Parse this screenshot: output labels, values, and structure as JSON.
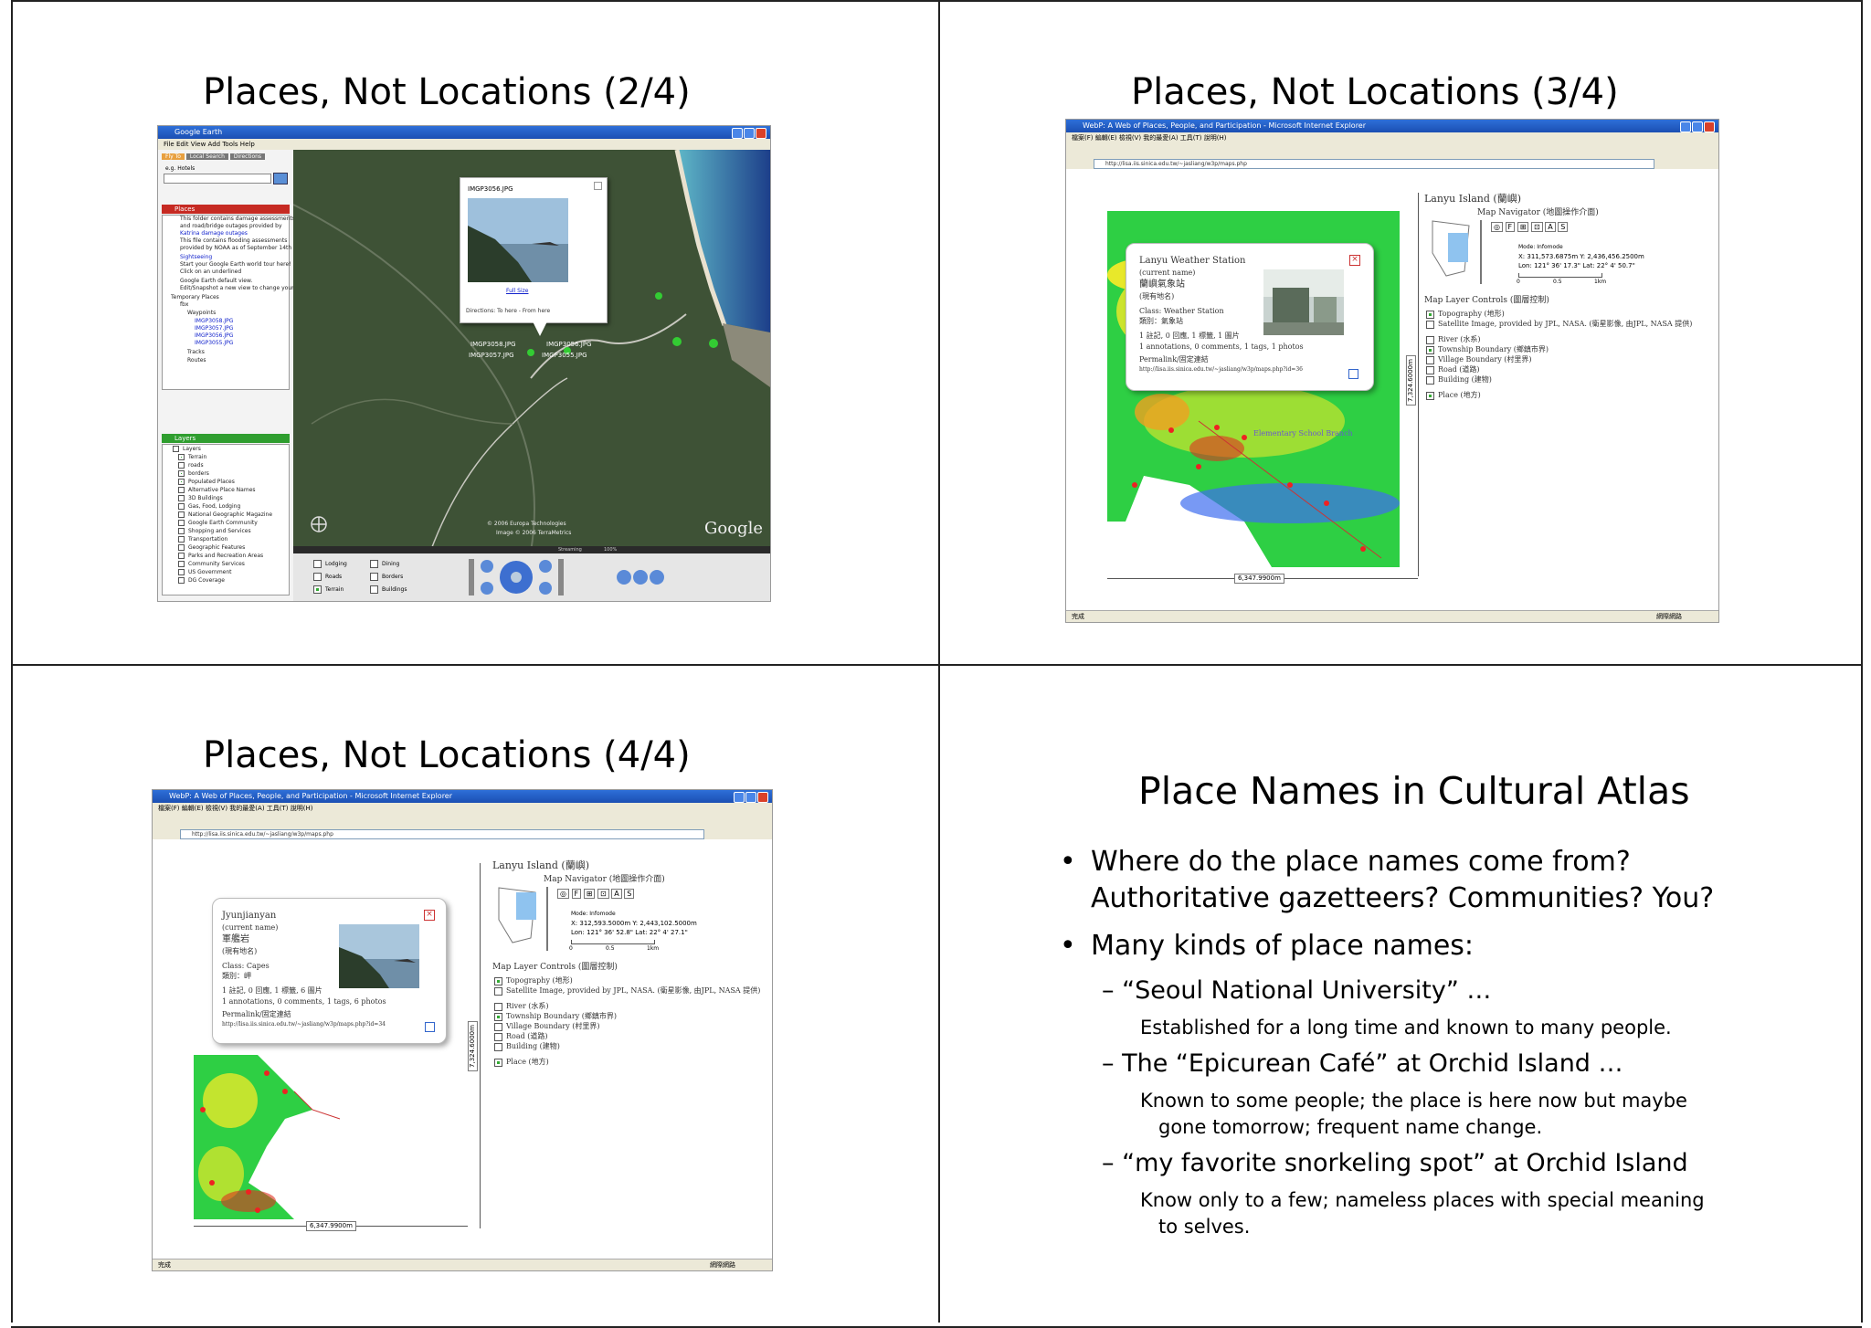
{
  "slides": {
    "s1": {
      "title": "Places, Not Locations (2/4)",
      "app_title": "Google Earth",
      "menu": "File  Edit  View  Add  Tools  Help",
      "tabs": [
        "Fly To",
        "Local Search",
        "Directions"
      ],
      "search_hint": "e.g. Hotels",
      "places_header": "Places",
      "places_items": [
        "This folder contains damage assessments",
        "and road/bridge outages provided by",
        "Katrina damage outages",
        "This file contains flooding assessments",
        "provided by NOAA as of September 14th",
        "Sightseeing",
        "Start your Google Earth world tour here!",
        "Click on an underlined",
        "Google Earth default view.",
        "Edit/Snapshot a new view to change your",
        "Temporary Places",
        "fbx",
        "Waypoints",
        "IMGP3058.JPG",
        "IMGP3057.JPG",
        "IMGP3056.JPG",
        "IMGP3055.JPG",
        "Tracks",
        "Routes"
      ],
      "layers_header": "Layers",
      "layers_items": [
        "Layers",
        "Terrain",
        "roads",
        "borders",
        "Populated Places",
        "Alternative Place Names",
        "3D Buildings",
        "Gas, Food, Lodging",
        "National Geographic Magazine",
        "Google Earth Community",
        "Shopping and Services",
        "Transportation",
        "Geographic Features",
        "Parks and Recreation Areas",
        "Community Services",
        "US Government",
        "DG Coverage"
      ],
      "popup_title": "IMGP3056.JPG",
      "popup_link": "Full Size",
      "popup_directions": "Directions: To here - From here",
      "waypoint_labels": [
        "IMGP3056.JPG",
        "IMGP3058.JPG",
        "IMGP3057.JPG",
        "IMGP3055.JPG"
      ],
      "copyright1": "© 2006 Europa Technologies",
      "copyright2": "Image © 2006 TerraMetrics",
      "streaming": "Streaming",
      "streaming_pct": "100%",
      "logo": "Google",
      "bottom_layers": [
        "Lodging",
        "Dining",
        "Roads",
        "Borders",
        "Terrain",
        "Buildings"
      ]
    },
    "s2": {
      "title": "Places, Not Locations (3/4)",
      "window_title": "WebP: A Web of Places, People, and Participation - Microsoft Internet Explorer",
      "menu": "檔案(F)  編輯(E)  檢視(V)  我的最愛(A)  工具(T)  說明(H)",
      "address": "http://lisa.iis.sinica.edu.tw/~jasliang/w3p/maps.php",
      "island_title": "Lanyu Island (蘭嶼)",
      "navigator_title": "Map Navigator (地圖操作介面)",
      "nav_buttons": [
        "F",
        "A",
        "S"
      ],
      "mode": "Mode: Infomode",
      "xy": "X: 311,573.6875m   Y: 2,436,456.2500m",
      "lonlat": "Lon: 121° 36' 17.3\"   Lat: 22° 4' 50.7\"",
      "scale_labels": [
        "0",
        "0.5",
        "1km"
      ],
      "layer_controls_title": "Map Layer Controls (圖層控制)",
      "layers": [
        {
          "label": "Topography (地形)",
          "checked": true
        },
        {
          "label": "Satellite Image, provided by JPL, NASA. (衛星影像, 由JPL, NASA 提供)",
          "checked": false
        },
        {
          "label": "River (水系)",
          "checked": false
        },
        {
          "label": "Township Boundary (鄉鎮市界)",
          "checked": true
        },
        {
          "label": "Village Boundary (村里界)",
          "checked": false
        },
        {
          "label": "Road (道路)",
          "checked": false
        },
        {
          "label": "Building (建物)",
          "checked": false
        },
        {
          "label": "Place (地方)",
          "checked": true
        }
      ],
      "popup_lines": [
        "Lanyu Weather Station",
        "(current name)",
        "蘭嶼氣象站",
        "(現有地名)",
        "Class: Weather Station",
        "類別：氣象站",
        "1 註記, 0 回應, 1 標籤, 1 圖片",
        "1 annotations, 0 comments, 1 tags, 1 photos",
        "Permalink/固定連結",
        "http://lisa.iis.sinica.edu.tw/~jasliang/w3p/maps.php?id=36"
      ],
      "map_labels": [
        "Elementary School Branch",
        "Lanyu Weather Station"
      ],
      "width_label": "6,347.9900m",
      "height_label": "7,324.6000m",
      "status_left": "完成",
      "status_right": "網際網路"
    },
    "s3": {
      "title": "Places, Not Locations (4/4)",
      "window_title": "WebP: A Web of Places, People, and Participation - Microsoft Internet Explorer",
      "menu": "檔案(F)  編輯(E)  檢視(V)  我的最愛(A)  工具(T)  說明(H)",
      "address": "http://lisa.iis.sinica.edu.tw/~jasliang/w3p/maps.php",
      "island_title": "Lanyu Island (蘭嶼)",
      "navigator_title": "Map Navigator (地圖操作介面)",
      "nav_buttons": [
        "F",
        "A",
        "S"
      ],
      "mode": "Mode: Infomode",
      "xy": "X: 312,593.5000m   Y: 2,443,102.5000m",
      "lonlat": "Lon: 121° 36' 52.8\"   Lat: 22° 4' 27.1\"",
      "scale_labels": [
        "0",
        "0.5",
        "1km"
      ],
      "layer_controls_title": "Map Layer Controls (圖層控制)",
      "layers": [
        {
          "label": "Topography (地形)",
          "checked": true
        },
        {
          "label": "Satellite Image, provided by JPL, NASA. (衛星影像, 由JPL, NASA 提供)",
          "checked": false
        },
        {
          "label": "River (水系)",
          "checked": false
        },
        {
          "label": "Township Boundary (鄉鎮市界)",
          "checked": true
        },
        {
          "label": "Village Boundary (村里界)",
          "checked": false
        },
        {
          "label": "Road (道路)",
          "checked": false
        },
        {
          "label": "Building (建物)",
          "checked": false
        },
        {
          "label": "Place (地方)",
          "checked": true
        }
      ],
      "popup_lines": [
        "Jyunjianyan",
        "(current name)",
        "軍艦岩",
        "(現有地名)",
        "Class: Capes",
        "類別：岬",
        "1 註記, 0 回應, 1 標籤, 6 圖片",
        "1 annotations, 0 comments, 1 tags, 6 photos",
        "Permalink/固定連結",
        "http://lisa.iis.sinica.edu.tw/~jasliang/w3p/maps.php?id=34"
      ],
      "width_label": "6,347.9900m",
      "height_label": "7,324.6000m",
      "status_left": "完成",
      "status_right": "網際網路"
    },
    "s4": {
      "title": "Place Names in Cultural Atlas",
      "bullet1_line1": "Where do the place names come from?",
      "bullet1_line2": "Authoritative gazetteers? Communities? You?",
      "bullet2": "Many kinds of place names:",
      "items": [
        {
          "head": "– “Seoul National University” …",
          "notes": [
            "Established for a long time and known to many people."
          ]
        },
        {
          "head": "– The “Epicurean Café” at Orchid Island …",
          "notes": [
            "Known to some people; the place is here now but maybe",
            "gone tomorrow; frequent name change."
          ]
        },
        {
          "head": "– “my favorite snorkeling spot” at Orchid Island",
          "notes": [
            "Know only to a few; nameless places with special meaning",
            "to selves."
          ]
        }
      ]
    }
  }
}
